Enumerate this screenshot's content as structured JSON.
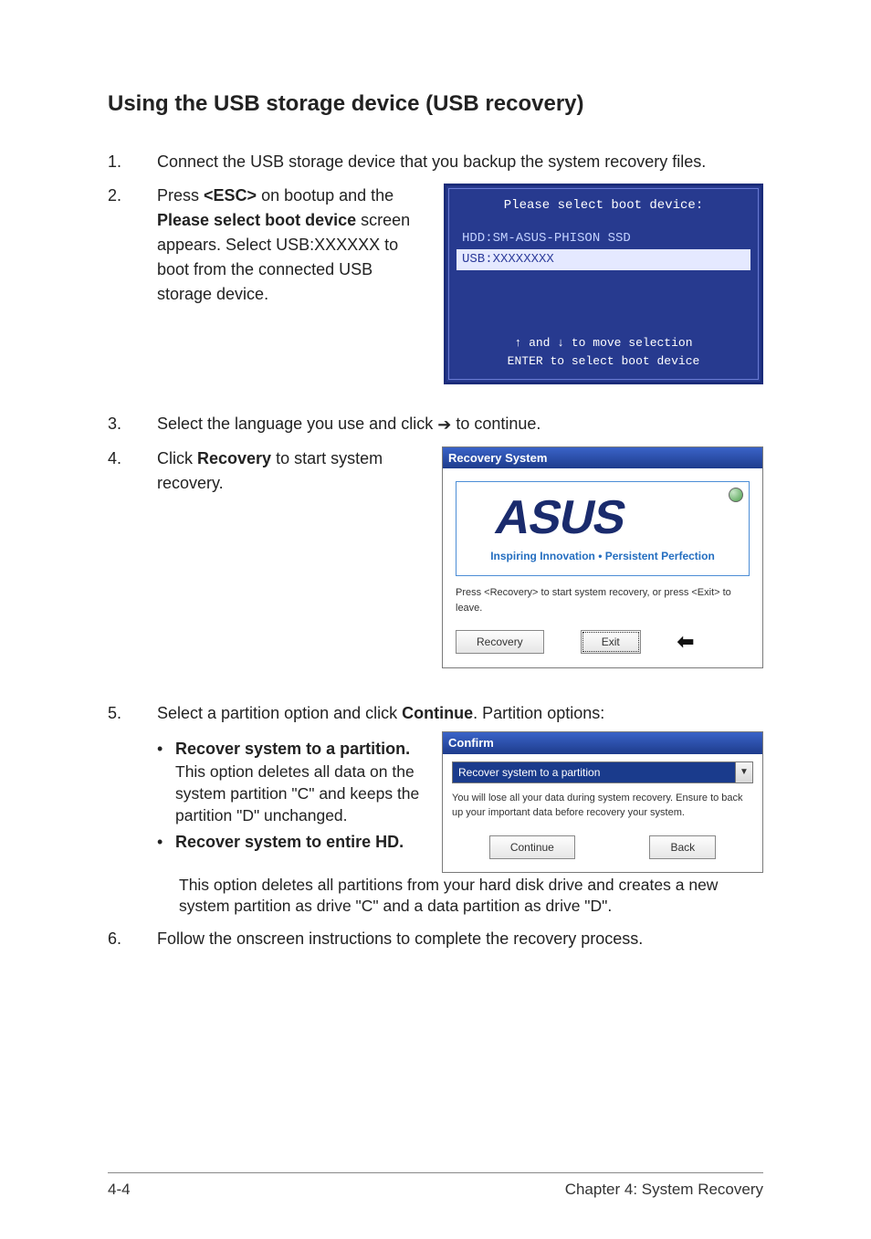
{
  "title": "Using the USB storage device (USB recovery)",
  "steps": {
    "s1": {
      "num": "1.",
      "text_a": "Connect the USB storage device that you backup the system recovery files."
    },
    "s2": {
      "num": "2.",
      "text_a": "Press ",
      "bold_esc": "<ESC>",
      "text_b": " on bootup and the ",
      "bold_please": "Please select boot device",
      "text_c": " screen appears. Select USB:XXXXXX to boot from the connected USB storage device."
    },
    "s3": {
      "num": "3.",
      "text_a": "Select the language you use and click ",
      "text_b": " to continue."
    },
    "s4": {
      "num": "4.",
      "text_a": "Click ",
      "bold_rec": "Recovery",
      "text_b": " to start system recovery."
    },
    "s5": {
      "num": "5.",
      "text_a": "Select a partition option and click ",
      "bold_cont": "Continue",
      "text_b": ". Partition options:"
    },
    "s6": {
      "num": "6.",
      "text_a": "Follow the onscreen instructions to complete the recovery process."
    }
  },
  "bullets": {
    "b1": {
      "title": "Recover system to a partition.",
      "desc": "This option deletes all data on the system partition \"C\" and keeps the partition \"D\" unchanged."
    },
    "b2": {
      "title": "Recover system to entire HD.",
      "desc": "This option deletes all partitions from your hard disk drive and creates a new system partition as drive \"C\" and a data partition as drive \"D\"."
    }
  },
  "bios": {
    "title": "Please select boot device:",
    "row1": "HDD:SM-ASUS-PHISON SSD",
    "row2": "USB:XXXXXXXX",
    "footer1": "↑ and ↓ to move selection",
    "footer2": "ENTER to select boot device"
  },
  "recovery_win": {
    "title": "Recovery System",
    "logo_text": "ASUS",
    "tagline": "Inspiring Innovation • Persistent Perfection",
    "instr": "Press <Recovery> to start system recovery, or press <Exit> to leave.",
    "btn_recovery": "Recovery",
    "btn_exit": "Exit"
  },
  "confirm_win": {
    "title": "Confirm",
    "selected": "Recover system to a partition",
    "msg": "You will lose all your data during system recovery. Ensure to back up your important data before recovery your system.",
    "btn_continue": "Continue",
    "btn_back": "Back"
  },
  "arrow_right": "➔",
  "arrow_left": "⬅",
  "dropdown_caret": "▼",
  "footer": {
    "left": "4-4",
    "right": "Chapter 4: System Recovery"
  }
}
